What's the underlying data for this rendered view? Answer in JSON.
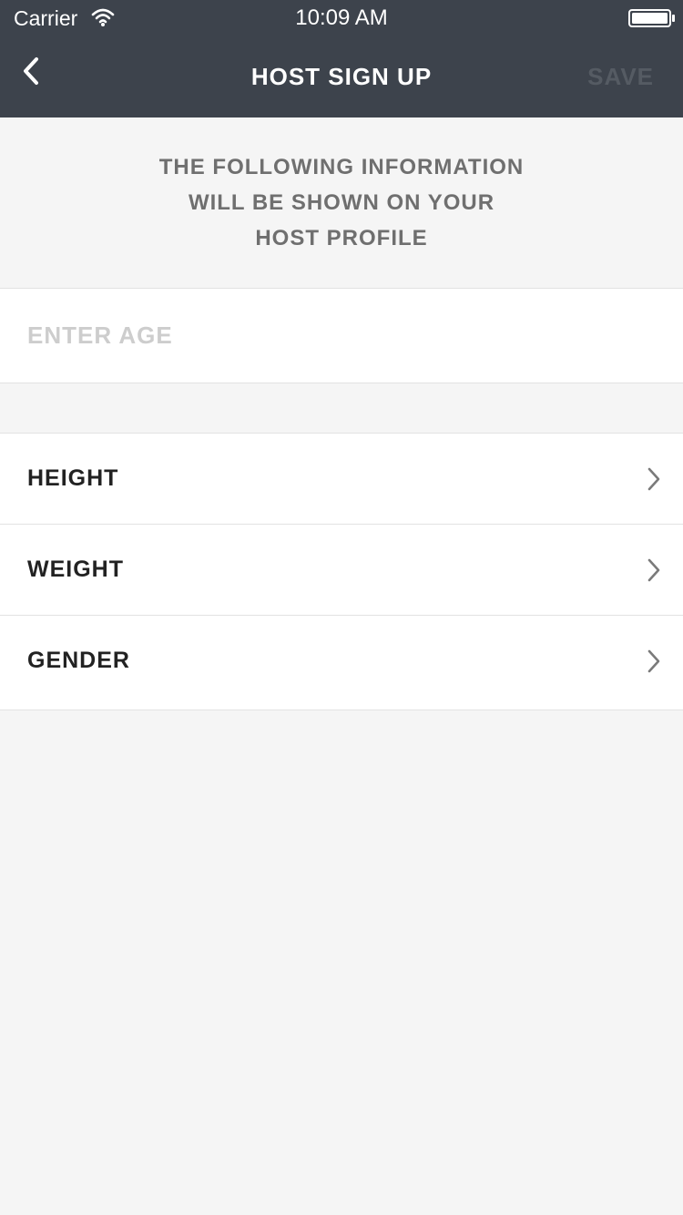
{
  "status_bar": {
    "carrier": "Carrier",
    "time": "10:09 AM",
    "wifi_icon": "wifi-icon",
    "battery_icon": "battery-icon"
  },
  "nav": {
    "back_icon": "chevron-left-icon",
    "title": "HOST SIGN UP",
    "save_label": "SAVE"
  },
  "info": {
    "lines": [
      "THE FOLLOWING INFORMATION",
      "WILL BE SHOWN ON YOUR",
      "HOST PROFILE"
    ]
  },
  "age": {
    "placeholder": "ENTER AGE",
    "value": ""
  },
  "options": [
    {
      "label": "HEIGHT",
      "icon": "chevron-right-icon"
    },
    {
      "label": "WEIGHT",
      "icon": "chevron-right-icon"
    },
    {
      "label": "GENDER",
      "icon": "chevron-right-icon"
    }
  ],
  "colors": {
    "header_bg": "#3d434c",
    "page_bg": "#f5f5f5",
    "save_disabled": "#555b63",
    "info_text": "#6f6f6f",
    "placeholder": "#cdcdcd",
    "row_text": "#222222"
  }
}
